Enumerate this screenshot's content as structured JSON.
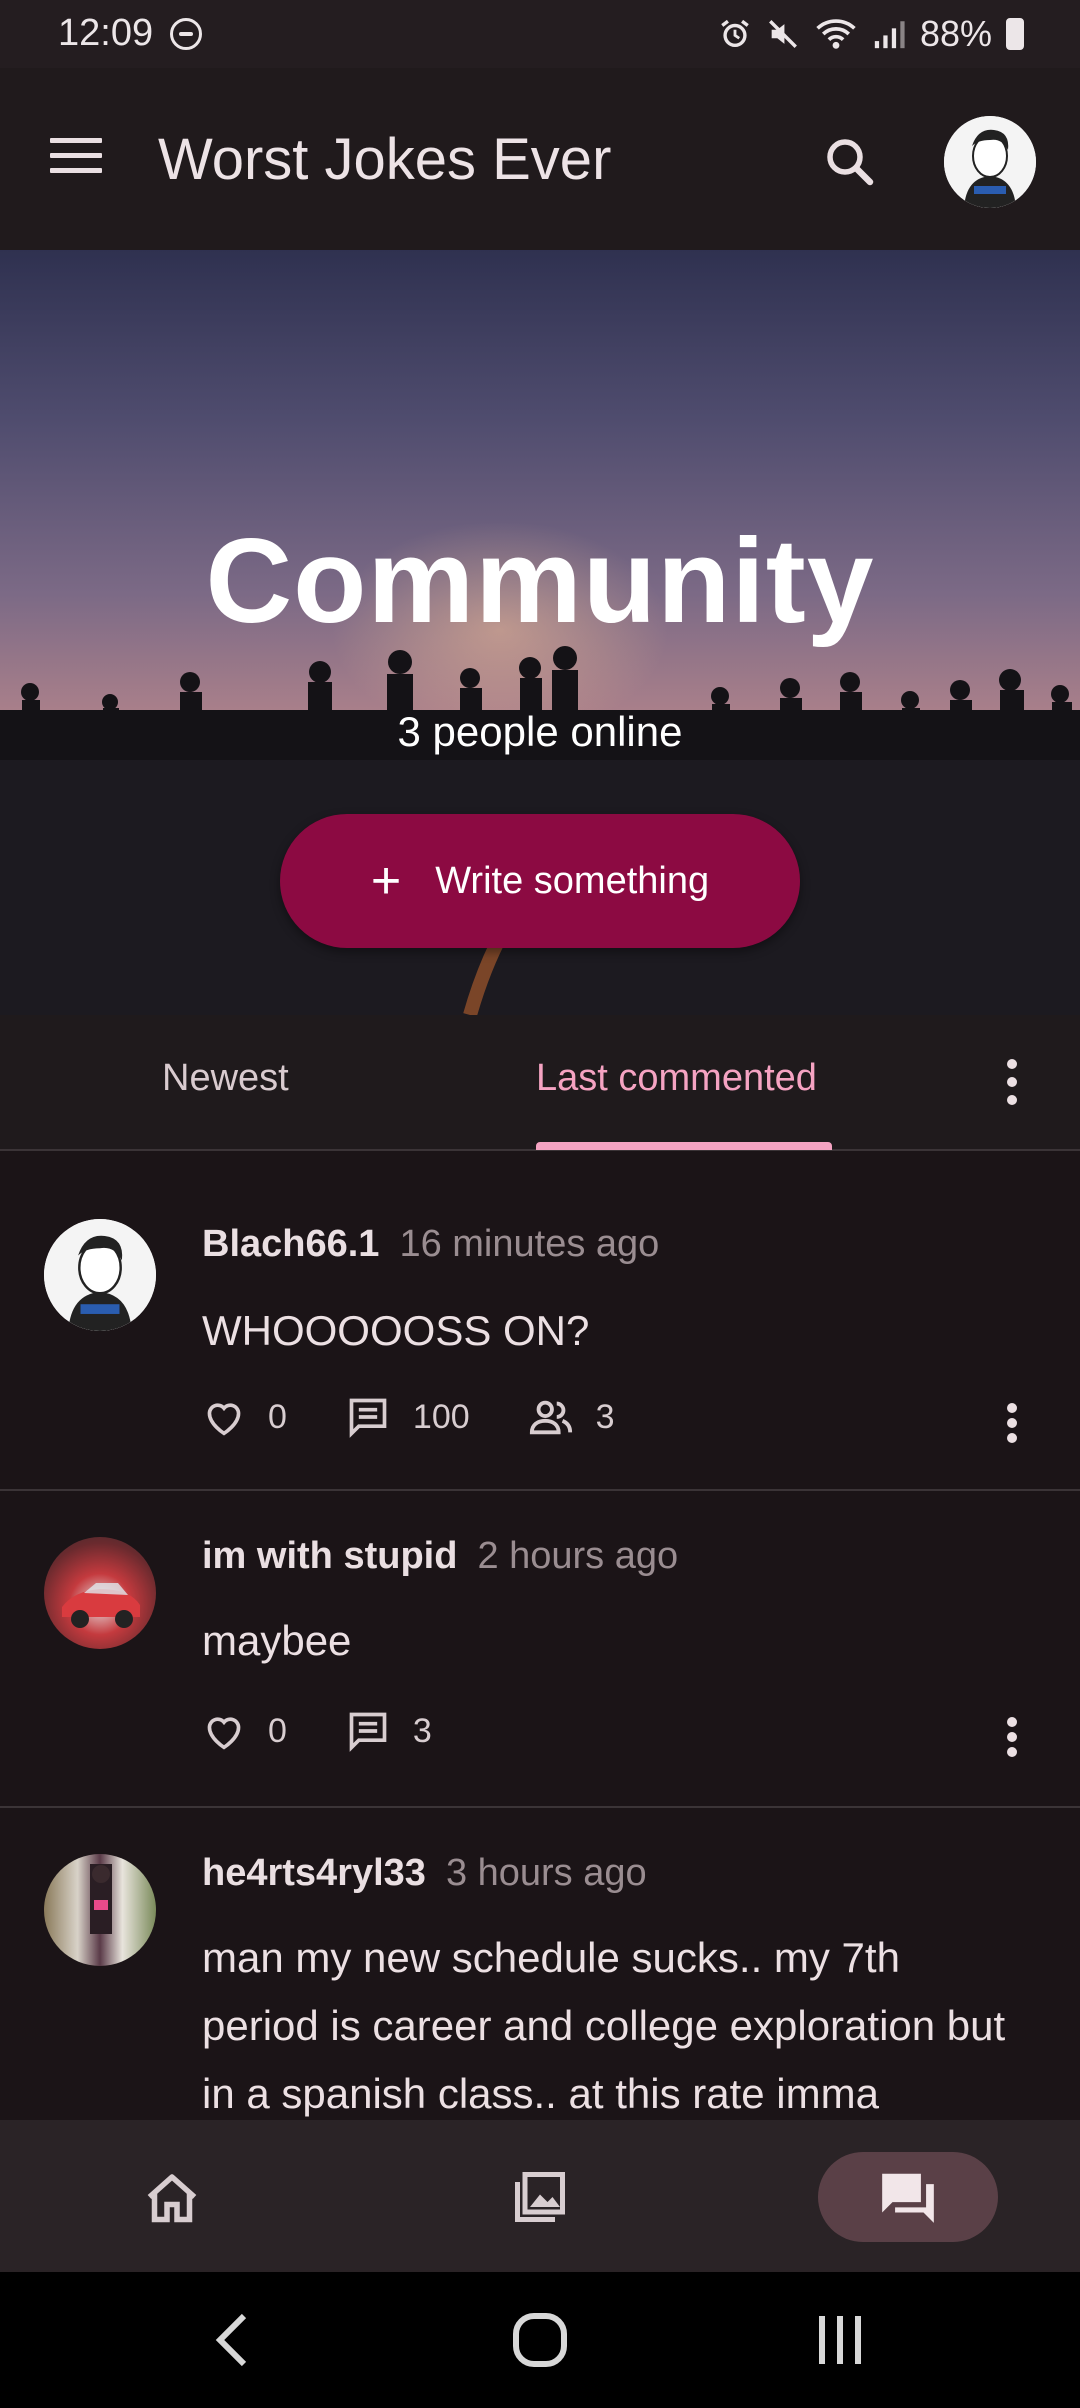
{
  "status_bar": {
    "time": "12:09",
    "battery": "88%"
  },
  "app_bar": {
    "title": "Worst Jokes Ever"
  },
  "hero": {
    "title": "Community",
    "subtitle": "3 people online",
    "write_button_label": "Write something",
    "write_button_icon": "plus"
  },
  "tabs": [
    {
      "label": "Newest",
      "active": false
    },
    {
      "label": "Last commented",
      "active": true
    }
  ],
  "posts": [
    {
      "author": "Blach66.1",
      "time": "16 minutes ago",
      "body": "WHOOOOOSS ON?",
      "likes": "0",
      "comments": "100",
      "participants": "3"
    },
    {
      "author": "im with stupid",
      "time": "2 hours ago",
      "body": "maybee",
      "likes": "0",
      "comments": "3"
    },
    {
      "author": "he4rts4ryl33",
      "time": "3 hours ago",
      "body": "man my new schedule sucks.. my 7th period is career and college exploration but in a spanish class.. at this rate imma"
    }
  ],
  "colors": {
    "accent": "#f5a3c2",
    "primary_button": "#8c0a42",
    "background": "#1b1417",
    "nav_active": "#5a4047"
  }
}
